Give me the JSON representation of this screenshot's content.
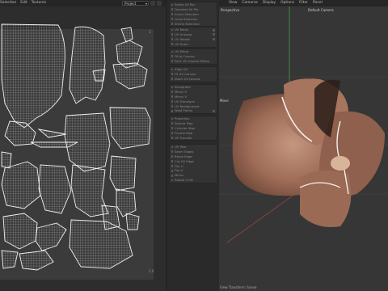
{
  "uv_editor": {
    "menu": [
      "Selection",
      "Edit",
      "Textures"
    ],
    "project_select": "Project",
    "corner_top_right": "1",
    "corner_bottom_right": "1.0"
  },
  "tools_panel": {
    "items": [
      "Select All Pts",
      "Deselect All Pts",
      "Invert Selection",
      "Grow Selection",
      "Shrink Selection",
      "UV Relax",
      "UV Unwrap",
      "UV Rotate",
      "UV Scale",
      "UV Mirror",
      "Fit to Canvas",
      "Pack UV Islands Fitting",
      "Align UV",
      "Fit UV Canvas",
      "Stack UV Islands",
      "Straighten",
      "Mirror U",
      "Mirror V",
      "UV Transform",
      "UV Realignment",
      "Weld Points",
      "Projection",
      "Sphere Map",
      "Cylinder Map",
      "Frontal Map",
      "UV Transfer",
      "UV Peel",
      "Seam Edges",
      "Break Edge",
      "Cut UV Edge",
      "Flip U",
      "Flip V",
      "Mirror",
      "Rotate CCW"
    ]
  },
  "viewport": {
    "menu": [
      "View",
      "Cameras",
      "Display",
      "Options",
      "Filter",
      "Panel"
    ],
    "view_name": "Perspective",
    "camera_label": "Default Camera",
    "handle_label": "Move",
    "status_bar": "View Transform: Scene"
  },
  "colors": {
    "accent_green": "#4ec24e",
    "accent_red": "#c24646",
    "flower": "#9a6a55"
  }
}
